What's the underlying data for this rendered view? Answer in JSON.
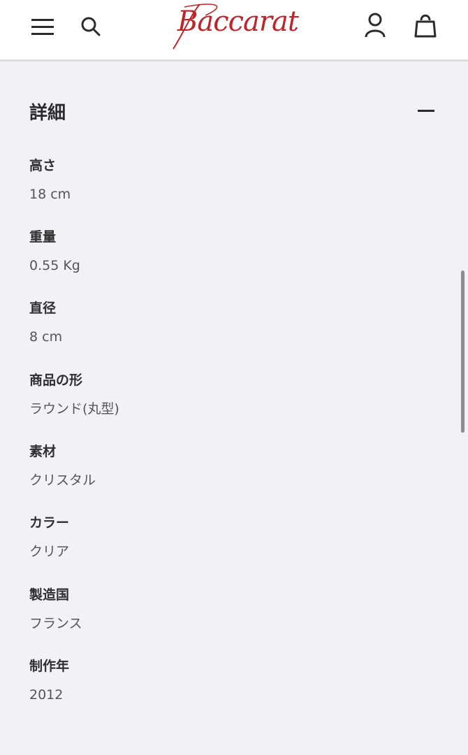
{
  "header": {
    "brand": "Baccarat",
    "brand_color": "#c0242b",
    "icons": [
      "menu-icon",
      "search-icon",
      "account-icon",
      "shopping-bag-icon"
    ]
  },
  "details": {
    "title": "詳細",
    "expanded": true,
    "specs": [
      {
        "label": "高さ",
        "value": "18 cm"
      },
      {
        "label": "重量",
        "value": "0.55 Kg"
      },
      {
        "label": "直径",
        "value": "8 cm"
      },
      {
        "label": "商品の形",
        "value": "ラウンド(丸型)"
      },
      {
        "label": "素材",
        "value": "クリスタル"
      },
      {
        "label": "カラー",
        "value": "クリア"
      },
      {
        "label": "製造国",
        "value": "フランス"
      },
      {
        "label": "制作年",
        "value": "2012"
      }
    ]
  }
}
